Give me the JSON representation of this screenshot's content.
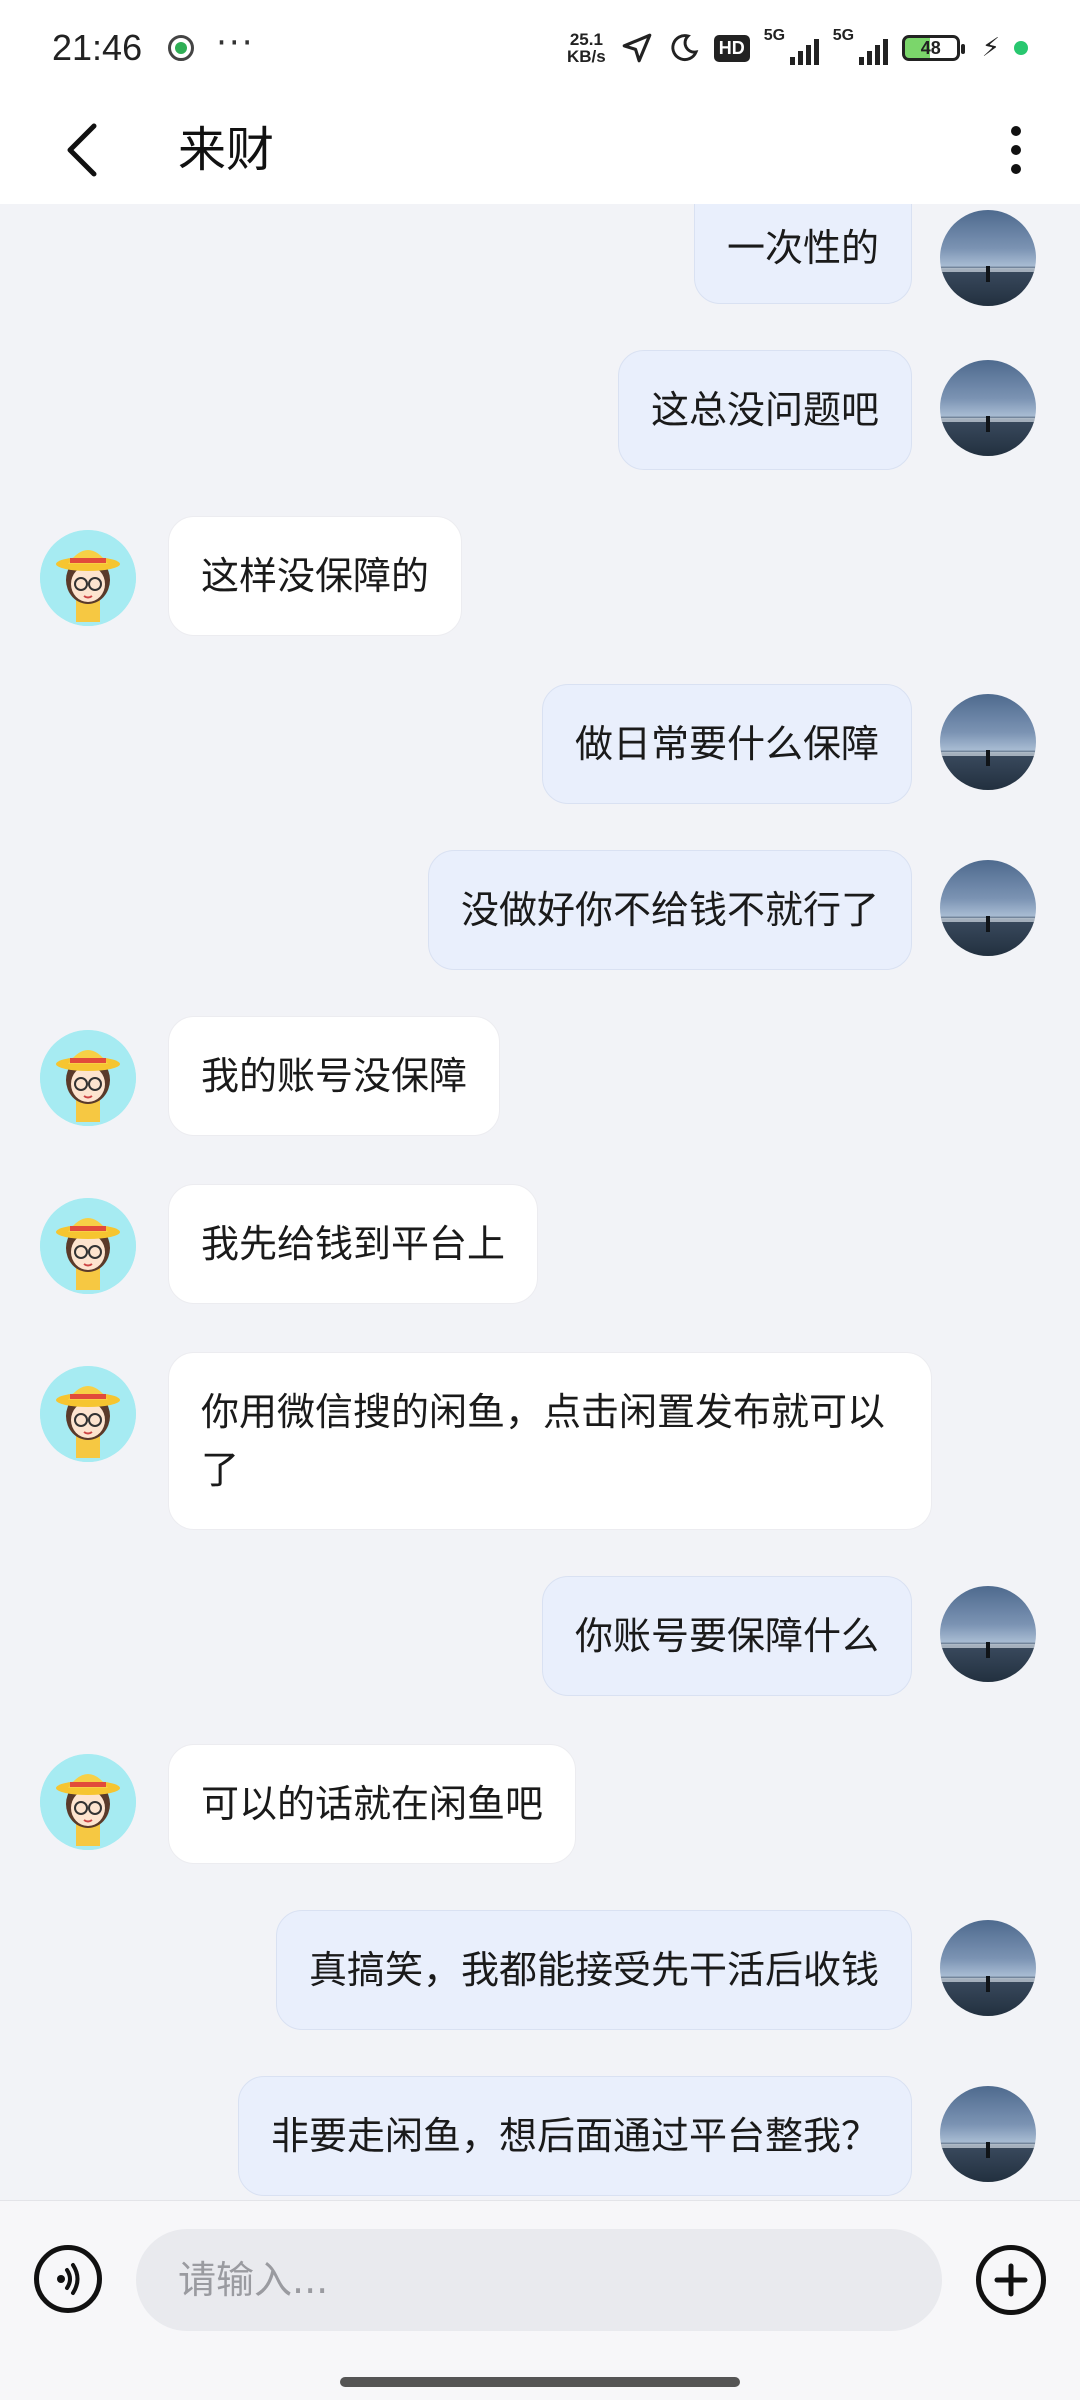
{
  "status_bar": {
    "time": "21:46",
    "speed_value": "25.1",
    "speed_unit": "KB/s",
    "hd_label": "HD",
    "signal1_label": "5G",
    "signal2_label": "5G",
    "battery": "48"
  },
  "header": {
    "title": "来财"
  },
  "messages": [
    {
      "sender": "me",
      "text": "一次性的"
    },
    {
      "sender": "me",
      "text": "这总没问题吧"
    },
    {
      "sender": "them",
      "text": "这样没保障的"
    },
    {
      "sender": "me",
      "text": "做日常要什么保障"
    },
    {
      "sender": "me",
      "text": "没做好你不给钱不就行了"
    },
    {
      "sender": "them",
      "text": "我的账号没保障"
    },
    {
      "sender": "them",
      "text": "我先给钱到平台上"
    },
    {
      "sender": "them",
      "text": "你用微信搜的闲鱼，点击闲置发布就可以了"
    },
    {
      "sender": "me",
      "text": "你账号要保障什么"
    },
    {
      "sender": "them",
      "text": "可以的话就在闲鱼吧"
    },
    {
      "sender": "me",
      "text": "真搞笑，我都能接受先干活后收钱"
    },
    {
      "sender": "me",
      "text": "非要走闲鱼，想后面通过平台整我？"
    }
  ],
  "input": {
    "placeholder": "请输入..."
  }
}
